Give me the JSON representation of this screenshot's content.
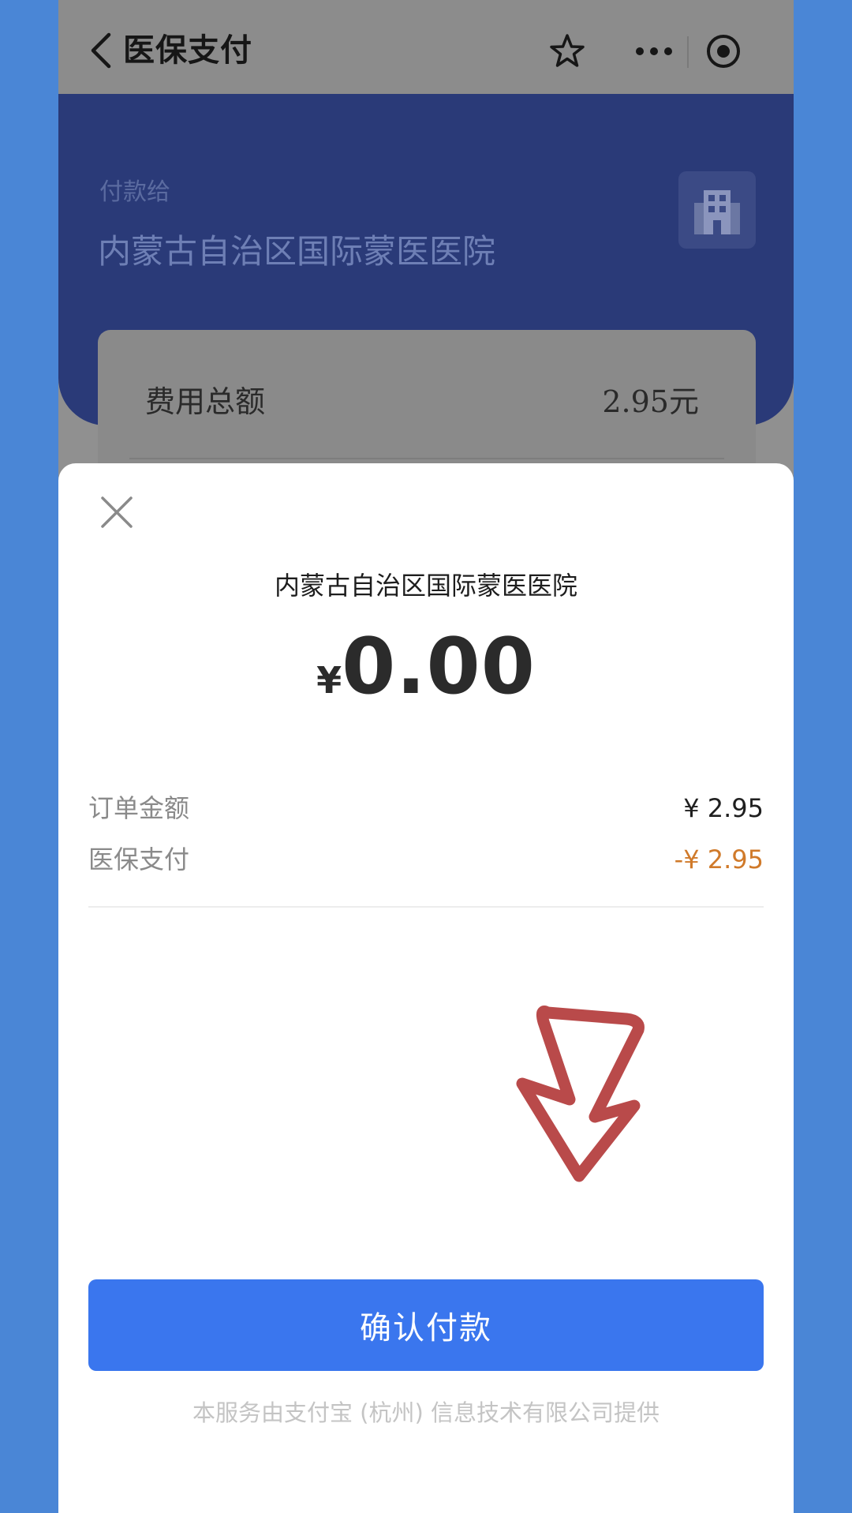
{
  "navbar": {
    "title": "医保支付",
    "icons": [
      "back-icon",
      "star-icon",
      "more-icon",
      "target-icon"
    ]
  },
  "header": {
    "pay_to_label": "付款给",
    "hospital_name": "内蒙古自治区国际蒙医医院",
    "fee_card": {
      "label": "费用总额",
      "value": "2.95元"
    }
  },
  "sheet": {
    "merchant_name": "内蒙古自治区国际蒙医医院",
    "currency_symbol": "¥",
    "amount": "0.00",
    "details": [
      {
        "label": "订单金额",
        "value": "¥ 2.95"
      },
      {
        "label": "医保支付",
        "value": "-¥ 2.95"
      }
    ],
    "confirm_button": "确认付款",
    "footer_note": "本服务由支付宝 (杭州) 信息技术有限公司提供"
  },
  "colors": {
    "primary_button": "#3a76ee",
    "discount_text": "#d07a2a",
    "annotation_arrow": "#b94a4a"
  }
}
